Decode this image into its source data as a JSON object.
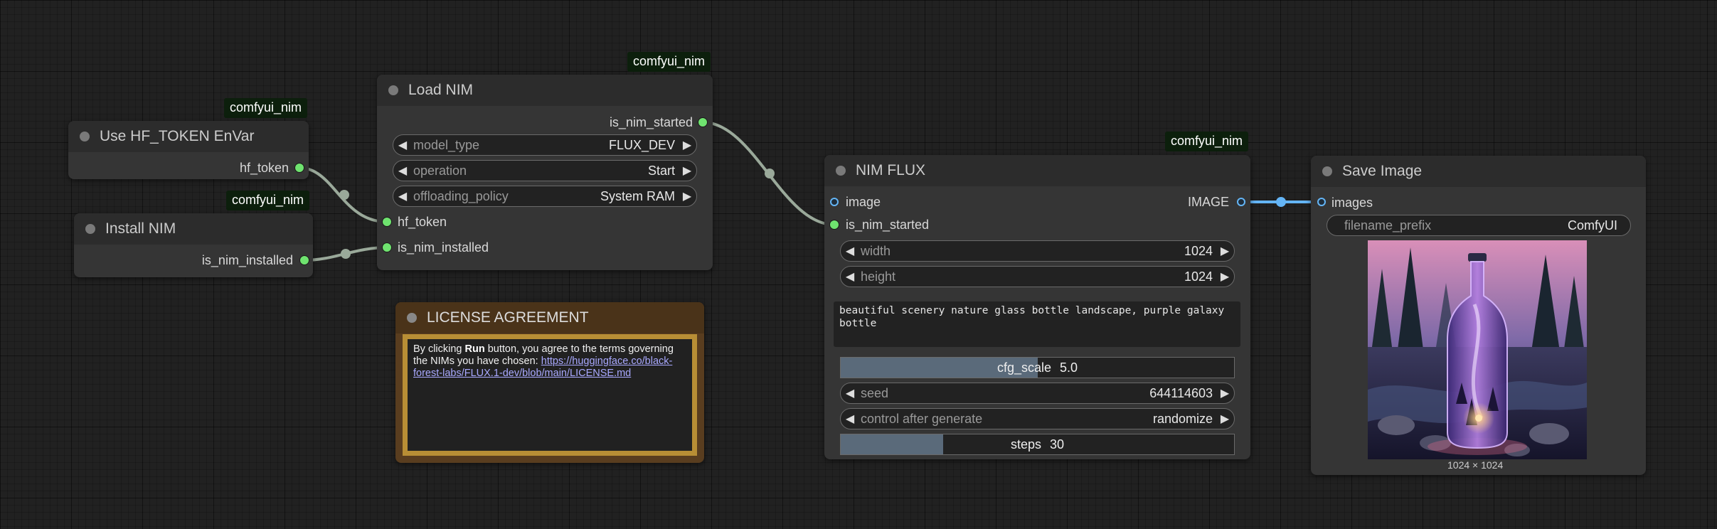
{
  "canvas": {
    "badge_label": "comfyui_nim"
  },
  "nodes": {
    "hf_token_node": {
      "title": "Use HF_TOKEN EnVar",
      "badge": "comfyui_nim",
      "output": "hf_token"
    },
    "install_nim_node": {
      "title": "Install NIM",
      "badge": "comfyui_nim",
      "output": "is_nim_installed"
    },
    "load_nim_node": {
      "title": "Load NIM",
      "badge": "comfyui_nim",
      "output": "is_nim_started",
      "widgets": [
        {
          "label": "model_type",
          "value": "FLUX_DEV"
        },
        {
          "label": "operation",
          "value": "Start"
        },
        {
          "label": "offloading_policy",
          "value": "System RAM"
        }
      ],
      "inputs": [
        "hf_token",
        "is_nim_installed"
      ]
    },
    "license_node": {
      "title": "LICENSE AGREEMENT",
      "text_before": "By clicking ",
      "text_bold": "Run",
      "text_after": " button, you agree to the terms governing the NIMs you have chosen: ",
      "link": "https://huggingface.co/black-forest-labs/FLUX.1-dev/blob/main/LICENSE.md"
    },
    "nim_flux_node": {
      "title": "NIM FLUX",
      "badge": "comfyui_nim",
      "inputs": [
        "image",
        "is_nim_started"
      ],
      "output": "IMAGE",
      "width": {
        "label": "width",
        "value": "1024"
      },
      "height": {
        "label": "height",
        "value": "1024"
      },
      "prompt": "beautiful scenery nature glass bottle landscape, purple galaxy bottle",
      "cfg_scale": {
        "label": "cfg_scale",
        "value": "5.0",
        "fill_fraction": 0.5
      },
      "seed": {
        "label": "seed",
        "value": "644114603"
      },
      "control_after_generate": {
        "label": "control after generate",
        "value": "randomize"
      },
      "steps": {
        "label": "steps",
        "value": "30",
        "fill_fraction": 0.26
      }
    },
    "save_image_node": {
      "title": "Save Image",
      "input": "images",
      "filename_prefix": {
        "label": "filename_prefix",
        "value": "ComfyUI"
      },
      "image_size": "1024 × 1024"
    }
  },
  "colors": {
    "int_slot": "#6fe36f",
    "image_slot": "#64b5f6",
    "wire_green": "#9aa99a",
    "wire_blue": "#64b5f6",
    "license_frame": "#b88e35"
  }
}
